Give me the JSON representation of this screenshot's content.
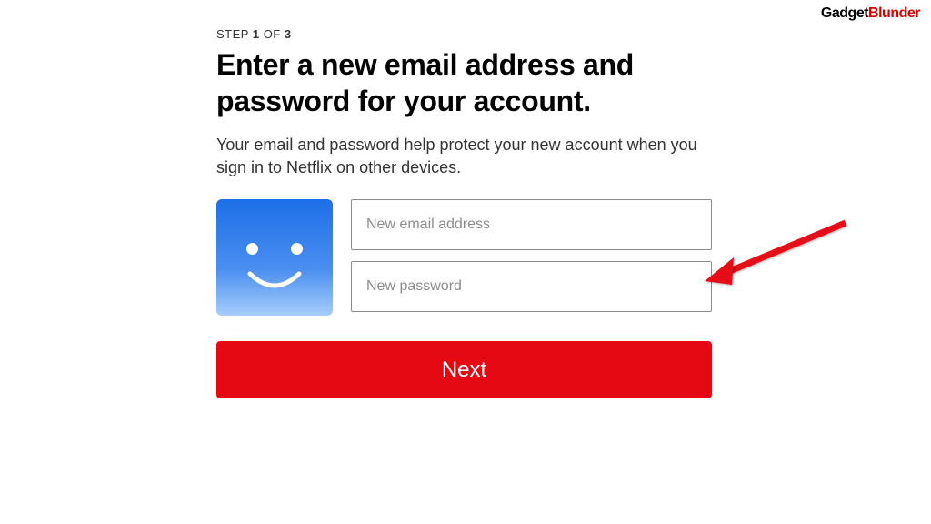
{
  "watermark": {
    "part1": "Gadget",
    "part2": "Blunder"
  },
  "step": {
    "prefix": "STEP ",
    "current": "1",
    "of": " OF ",
    "total": "3"
  },
  "heading": "Enter a new email address and password for your account.",
  "subtext": "Your email and password help protect your new account when you sign in to Netflix on other devices.",
  "inputs": {
    "email_placeholder": "New email address",
    "password_placeholder": "New password"
  },
  "next_label": "Next"
}
